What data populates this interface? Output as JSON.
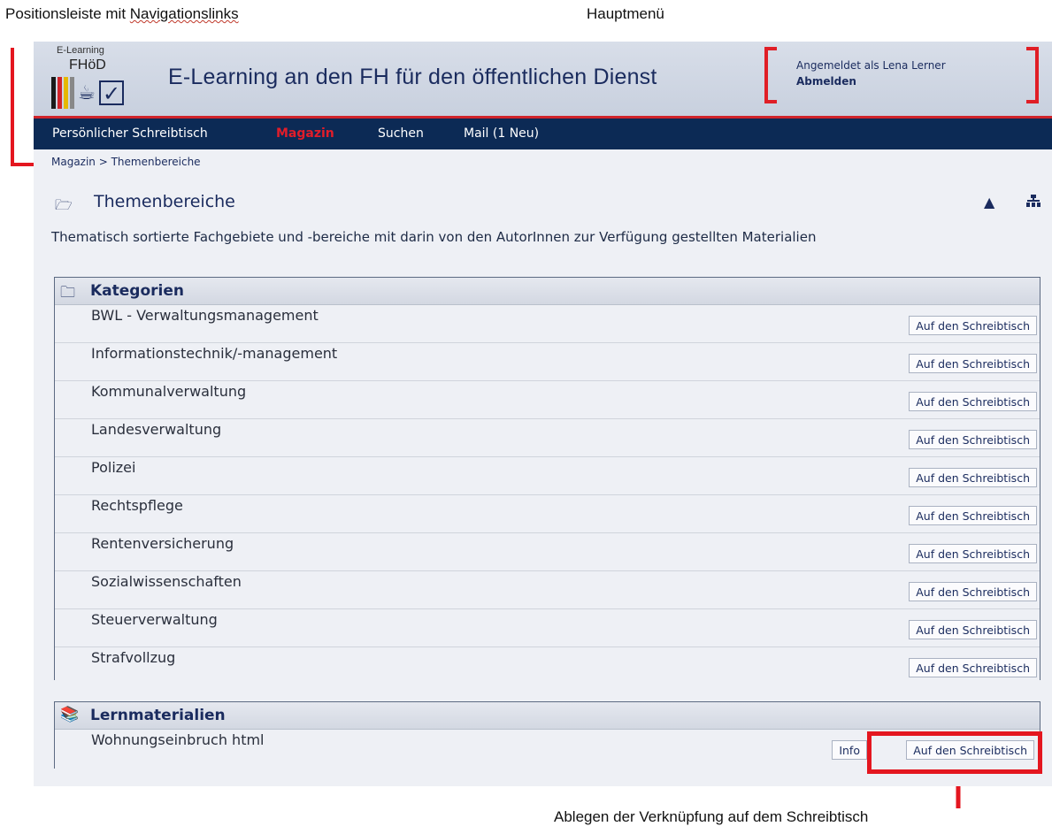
{
  "annotations": {
    "positionsleiste_prefix": "Positionsleiste mit ",
    "positionsleiste_link": "Navigationslinks",
    "hauptmenu": "Hauptmenü",
    "ablegen": "Ablegen der Verknüpfung auf dem Schreibtisch"
  },
  "header": {
    "logo_small": "E-Learning",
    "logo_fh": "FHöD",
    "title": "E-Learning an den FH für den öffentlichen Dienst",
    "user_line": "Angemeldet als Lena Lerner",
    "logout": "Abmelden"
  },
  "mainnav": {
    "items": [
      "Persönlicher Schreibtisch",
      "Magazin",
      "Suchen",
      "Mail (1 Neu)"
    ],
    "active": "Magazin"
  },
  "breadcrumb": "Magazin > Themenbereiche",
  "section": {
    "title": "Themenbereiche",
    "description": "Thematisch sortierte Fachgebiete und -bereiche mit darin von den AutorInnen zur Verfügung gestellten Materialien"
  },
  "kategorien": {
    "heading": "Kategorien",
    "button_label": "Auf den Schreibtisch",
    "items": [
      "BWL - Verwaltungsmanagement",
      "Informationstechnik/-management",
      "Kommunalverwaltung",
      "Landesverwaltung",
      "Polizei",
      "Rechtspflege",
      "Rentenversicherung",
      "Sozialwissenschaften",
      "Steuerverwaltung",
      "Strafvollzug"
    ]
  },
  "lernmaterialien": {
    "heading": "Lernmaterialien",
    "items": [
      {
        "name": "Wohnungseinbruch html",
        "info_label": "Info",
        "desk_label": "Auf den Schreibtisch"
      }
    ]
  },
  "colors": {
    "nav_bg": "#0c2a55",
    "accent_red": "#e11d2a",
    "text_blue": "#1a2b5e"
  }
}
